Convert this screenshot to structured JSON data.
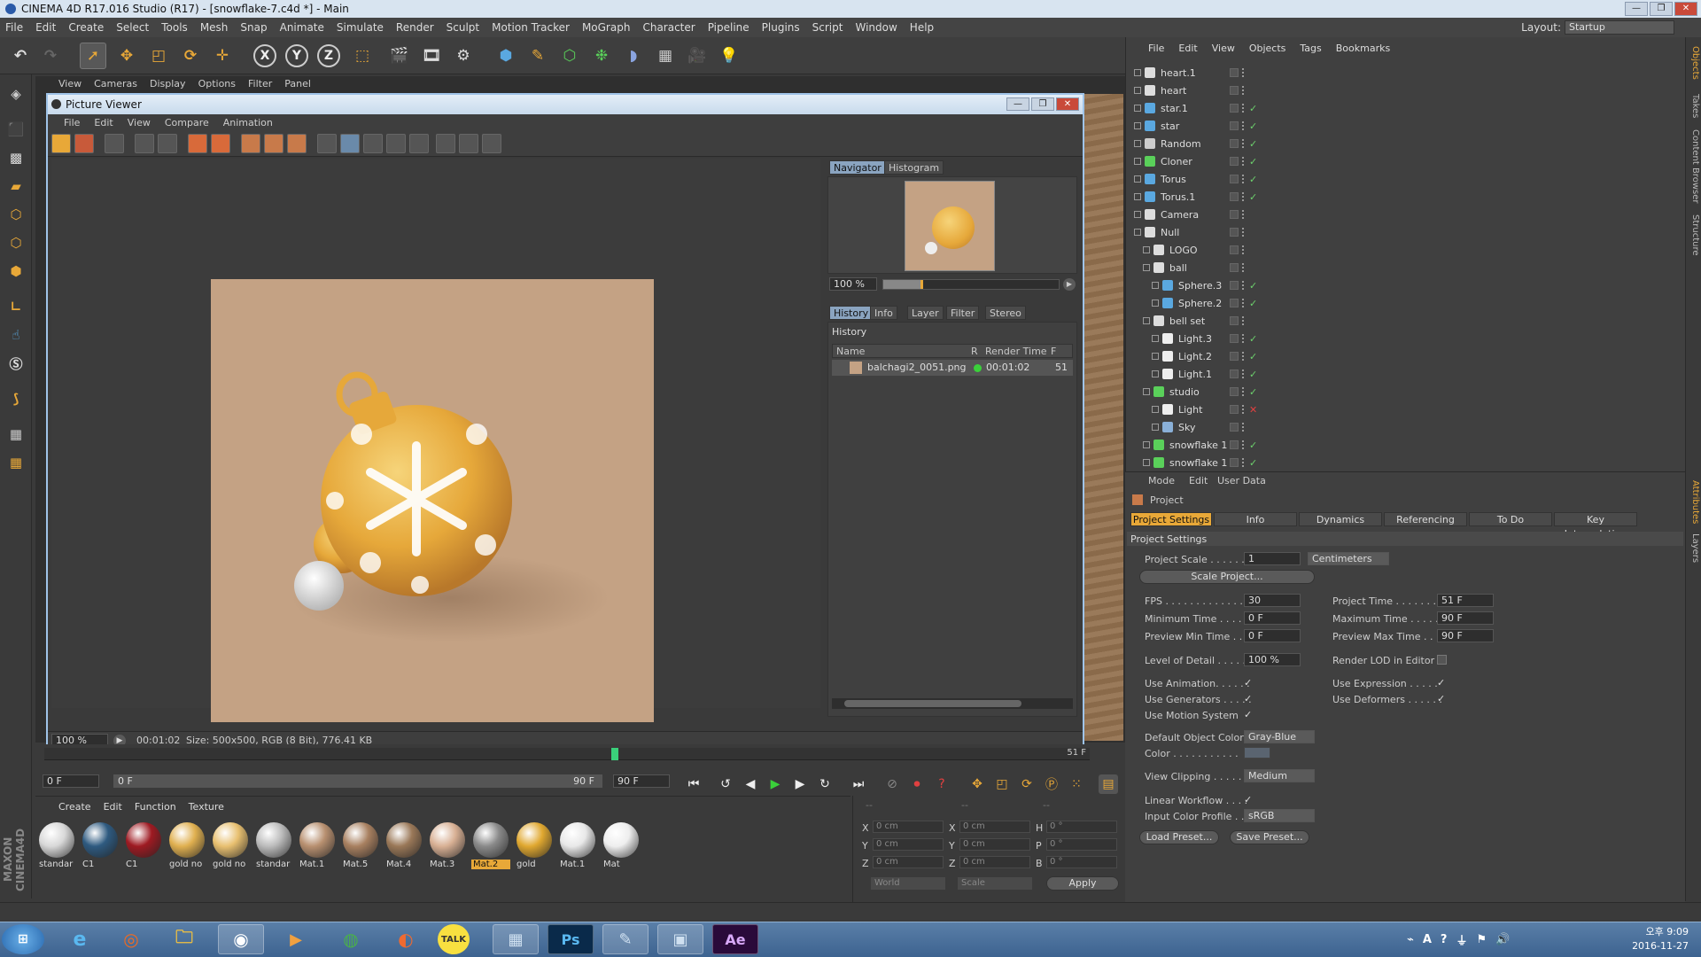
{
  "window": {
    "title": "CINEMA 4D R17.016 Studio (R17) - [snowflake-7.c4d *] - Main",
    "min": "—",
    "max": "❐",
    "close": "✕"
  },
  "menubar": [
    "File",
    "Edit",
    "Create",
    "Select",
    "Tools",
    "Mesh",
    "Snap",
    "Animate",
    "Simulate",
    "Render",
    "Sculpt",
    "Motion Tracker",
    "MoGraph",
    "Character",
    "Pipeline",
    "Plugins",
    "Script",
    "Window",
    "Help"
  ],
  "layout": {
    "label": "Layout:",
    "value": "Startup"
  },
  "toolbar_axes": [
    "X",
    "Y",
    "Z"
  ],
  "viewport_menu": [
    "View",
    "Cameras",
    "Display",
    "Options",
    "Filter",
    "Panel"
  ],
  "picture_viewer": {
    "title": "Picture Viewer",
    "menu": [
      "File",
      "Edit",
      "View",
      "Compare",
      "Animation"
    ],
    "zoom": "100 %",
    "time": "00:01:02",
    "size_info": "Size: 500x500, RGB (8 Bit), 776.41 KB",
    "nav_tabs": [
      "Navigator",
      "Histogram"
    ],
    "nav_zoom": "100 %",
    "side_tabs": [
      "History",
      "Info",
      "Layer",
      "Filter",
      "Stereo"
    ],
    "history_label": "History",
    "history_columns": [
      "Name",
      "R",
      "Render Time",
      "F"
    ],
    "history_row": {
      "name": "balchagi2_0051.png",
      "time": "00:01:02",
      "frame": "51"
    }
  },
  "object_manager": {
    "menu": [
      "File",
      "Edit",
      "View",
      "Objects",
      "Tags",
      "Bookmarks"
    ],
    "objects": [
      {
        "name": "heart.1",
        "icon": "null-icon",
        "check": ""
      },
      {
        "name": "heart",
        "icon": "null-icon",
        "check": ""
      },
      {
        "name": "star.1",
        "icon": "spline-icon",
        "check": "✓"
      },
      {
        "name": "star",
        "icon": "spline-icon",
        "check": "✓"
      },
      {
        "name": "Random",
        "icon": "effector-icon",
        "check": "✓"
      },
      {
        "name": "Cloner",
        "icon": "cloner-icon",
        "check": "✓"
      },
      {
        "name": "Torus",
        "icon": "torus-icon",
        "check": "✓"
      },
      {
        "name": "Torus.1",
        "icon": "torus-icon",
        "check": "✓"
      },
      {
        "name": "Camera",
        "icon": "camera-icon",
        "check": ""
      },
      {
        "name": "Null",
        "icon": "null-icon",
        "check": ""
      },
      {
        "name": "LOGO",
        "icon": "null-icon",
        "check": ""
      },
      {
        "name": "ball",
        "icon": "null-icon",
        "check": ""
      },
      {
        "name": "Sphere.3",
        "icon": "sphere-icon",
        "check": "✓"
      },
      {
        "name": "Sphere.2",
        "icon": "sphere-icon",
        "check": "✓"
      },
      {
        "name": "bell set",
        "icon": "null-icon",
        "check": ""
      },
      {
        "name": "Light.3",
        "icon": "light-icon",
        "check": "✓"
      },
      {
        "name": "Light.2",
        "icon": "light-icon",
        "check": "✓"
      },
      {
        "name": "Light.1",
        "icon": "light-icon",
        "check": "✓"
      },
      {
        "name": "studio",
        "icon": "object-icon",
        "check": "✓"
      },
      {
        "name": "Light",
        "icon": "light-icon",
        "check": "✕"
      },
      {
        "name": "Sky",
        "icon": "sky-icon",
        "check": ""
      },
      {
        "name": "snowflake 1",
        "icon": "object-icon",
        "check": "✓"
      },
      {
        "name": "snowflake 1",
        "icon": "object-icon",
        "check": "✓"
      }
    ]
  },
  "attributes": {
    "menu": [
      "Mode",
      "Edit",
      "User Data"
    ],
    "header": "Project",
    "tabs": [
      "Project Settings",
      "Info",
      "Dynamics",
      "Referencing",
      "To Do",
      "Key Interpolation"
    ],
    "section": "Project Settings",
    "project_scale_label": "Project Scale . . . . . .",
    "project_scale": "1",
    "project_scale_unit": "Centimeters",
    "scale_project_btn": "Scale Project...",
    "fps_label": "FPS . . . . . . . . . . . . . .",
    "fps": "30",
    "project_time_label": "Project Time . . . . . . .",
    "project_time": "51 F",
    "min_time_label": "Minimum Time . . . . . .",
    "min_time": "0 F",
    "max_time_label": "Maximum Time . . . . .",
    "max_time": "90 F",
    "prev_min_label": "Preview Min Time . . .",
    "prev_min": "0 F",
    "prev_max_label": "Preview Max Time . . .",
    "prev_max": "90 F",
    "lod_label": "Level of Detail . . . . .",
    "lod": "100 %",
    "render_lod_label": "Render LOD in Editor",
    "use_anim_label": "Use Animation. . . . . .",
    "use_expr_label": "Use Expression . . . . .",
    "use_gen_label": "Use Generators . . . . .",
    "use_def_label": "Use Deformers . . . . . .",
    "use_motion_label": "Use Motion System",
    "def_color_label": "Default Object Color",
    "def_color": "Gray-Blue",
    "color_label": "Color . . . . . . . . . . .",
    "view_clip_label": "View Clipping . . . . .",
    "view_clip": "Medium",
    "linear_label": "Linear Workflow . . . .",
    "input_profile_label": "Input Color Profile . .",
    "input_profile": "sRGB",
    "load_preset": "Load Preset...",
    "save_preset": "Save Preset...",
    "check": "✓"
  },
  "right_tabs": [
    "Objects",
    "Takes",
    "Content Browser",
    "Structure",
    "Attributes",
    "Layers"
  ],
  "timeline": {
    "start": "0 F",
    "range_start": "0 F",
    "range_end": "90 F",
    "end": "90 F",
    "ruler_end": "51 F"
  },
  "materials": {
    "menu": [
      "Create",
      "Edit",
      "Function",
      "Texture"
    ],
    "items": [
      {
        "label": "standar",
        "color": "#d8d8d8"
      },
      {
        "label": "C1",
        "color": "#2e5a80"
      },
      {
        "label": "C1",
        "color": "#9e1a22"
      },
      {
        "label": "gold no",
        "color": "#e0b050"
      },
      {
        "label": "gold no",
        "color": "#e8c070"
      },
      {
        "label": "standar",
        "color": "#bcbcbc"
      },
      {
        "label": "Mat.1",
        "color": "#b89070"
      },
      {
        "label": "Mat.5",
        "color": "#a88060"
      },
      {
        "label": "Mat.4",
        "color": "#9a7858"
      },
      {
        "label": "Mat.3",
        "color": "#d8b094"
      },
      {
        "label": "Mat.2",
        "color": "#8a8a8a"
      },
      {
        "label": "gold",
        "color": "#e0a830"
      },
      {
        "label": "Mat.1",
        "color": "#e8e8e8"
      },
      {
        "label": "Mat",
        "color": "#eeeeee"
      }
    ]
  },
  "coordinates": {
    "x": "0 cm",
    "y": "0 cm",
    "z": "0 cm",
    "sx": "0 cm",
    "sy": "0 cm",
    "sz": "0 cm",
    "h": "0 °",
    "p": "0 °",
    "b": "0 °",
    "world": "World",
    "scale": "Scale",
    "apply": "Apply"
  },
  "taskbar": {
    "time": "오후 9:09",
    "date": "2016-11-27"
  }
}
